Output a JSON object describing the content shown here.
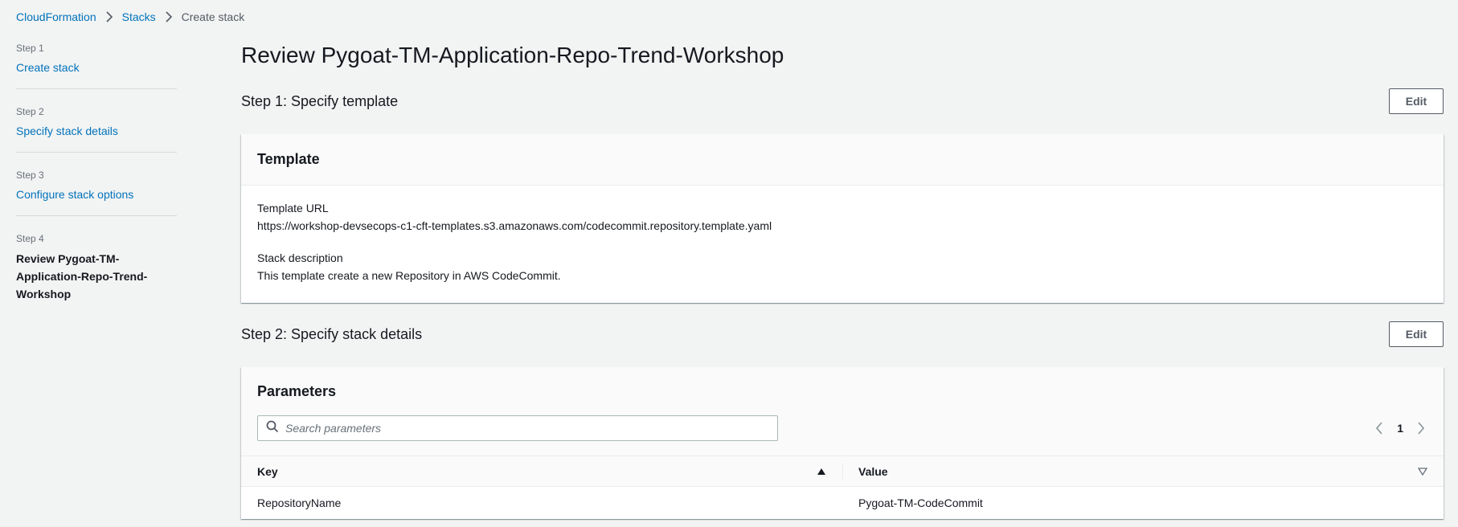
{
  "breadcrumb": {
    "items": [
      "CloudFormation",
      "Stacks"
    ],
    "current": "Create stack"
  },
  "steps": [
    {
      "num": "Step 1",
      "label": "Create stack"
    },
    {
      "num": "Step 2",
      "label": "Specify stack details"
    },
    {
      "num": "Step 3",
      "label": "Configure stack options"
    },
    {
      "num": "Step 4",
      "label": "Review Pygoat-TM-Application-Repo-Trend-Workshop"
    }
  ],
  "page": {
    "title": "Review Pygoat-TM-Application-Repo-Trend-Workshop"
  },
  "section1": {
    "title": "Step 1: Specify template",
    "edit_label": "Edit",
    "card_title": "Template",
    "template_url_label": "Template URL",
    "template_url_value": "https://workshop-devsecops-c1-cft-templates.s3.amazonaws.com/codecommit.repository.template.yaml",
    "stack_desc_label": "Stack description",
    "stack_desc_value": "This template create a new Repository in AWS CodeCommit."
  },
  "section2": {
    "title": "Step 2: Specify stack details",
    "edit_label": "Edit",
    "card_title": "Parameters",
    "search_placeholder": "Search parameters",
    "page_number": "1",
    "columns": {
      "key": "Key",
      "value": "Value"
    },
    "rows": [
      {
        "key": "RepositoryName",
        "value": "Pygoat-TM-CodeCommit"
      }
    ]
  },
  "colors": {
    "link": "#0073bb",
    "background": "#f2f3f3",
    "text": "#16191f"
  }
}
